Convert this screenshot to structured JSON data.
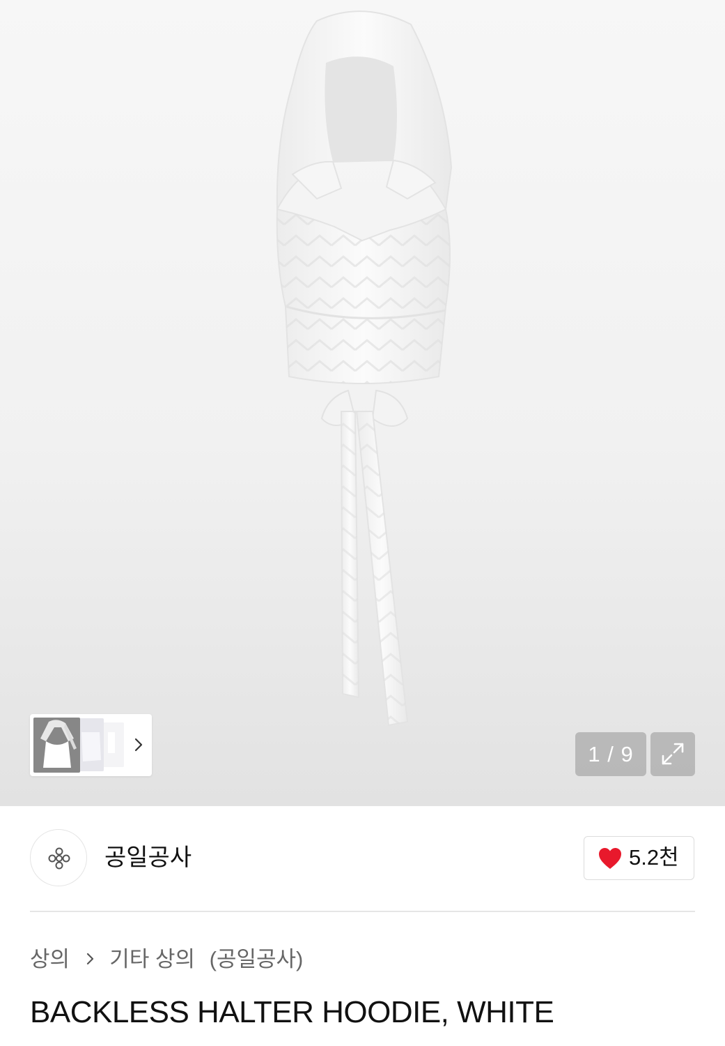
{
  "gallery": {
    "counter_current": "1",
    "counter_separator": "/",
    "counter_total": "9",
    "thumbnail_count": 3,
    "expand_icon": "expand-diagonal-icon",
    "next_icon": "chevron-right-icon"
  },
  "brand": {
    "name": "공일공사",
    "logo_icon": "brand-emblem-icon"
  },
  "like": {
    "icon": "heart-icon",
    "icon_color": "#e8192c",
    "count": "5.2천"
  },
  "breadcrumb": {
    "category": "상의",
    "separator_icon": "chevron-right-icon",
    "subcategory": "기타 상의",
    "brand_tag": "(공일공사)"
  },
  "product": {
    "title": "BACKLESS HALTER HOODIE, WHITE"
  }
}
